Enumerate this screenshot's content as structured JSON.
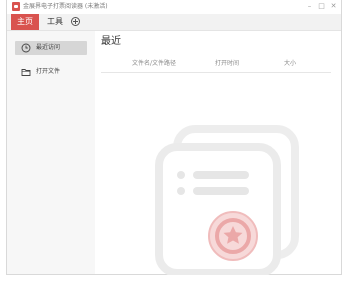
{
  "window": {
    "title": "金展界电子打票阅读器 (未激活)"
  },
  "menubar": {
    "tabs": [
      {
        "label": "主页",
        "active": true
      },
      {
        "label": "工具",
        "active": false
      }
    ],
    "add_tab_icon": "plus-circle-icon"
  },
  "sidebar": {
    "items": [
      {
        "label": "最近访问",
        "icon": "clock-icon",
        "active": true
      },
      {
        "label": "打开文件",
        "icon": "folder-icon",
        "active": false
      }
    ]
  },
  "main": {
    "section_title": "最近",
    "table": {
      "columns": [
        "文件名/文件路径",
        "打开时间",
        "大小"
      ],
      "rows": []
    }
  },
  "colors": {
    "accent": "#d9534f",
    "sidebar_bg": "#f7f7f7",
    "selected_item": "#d6d6d6"
  }
}
